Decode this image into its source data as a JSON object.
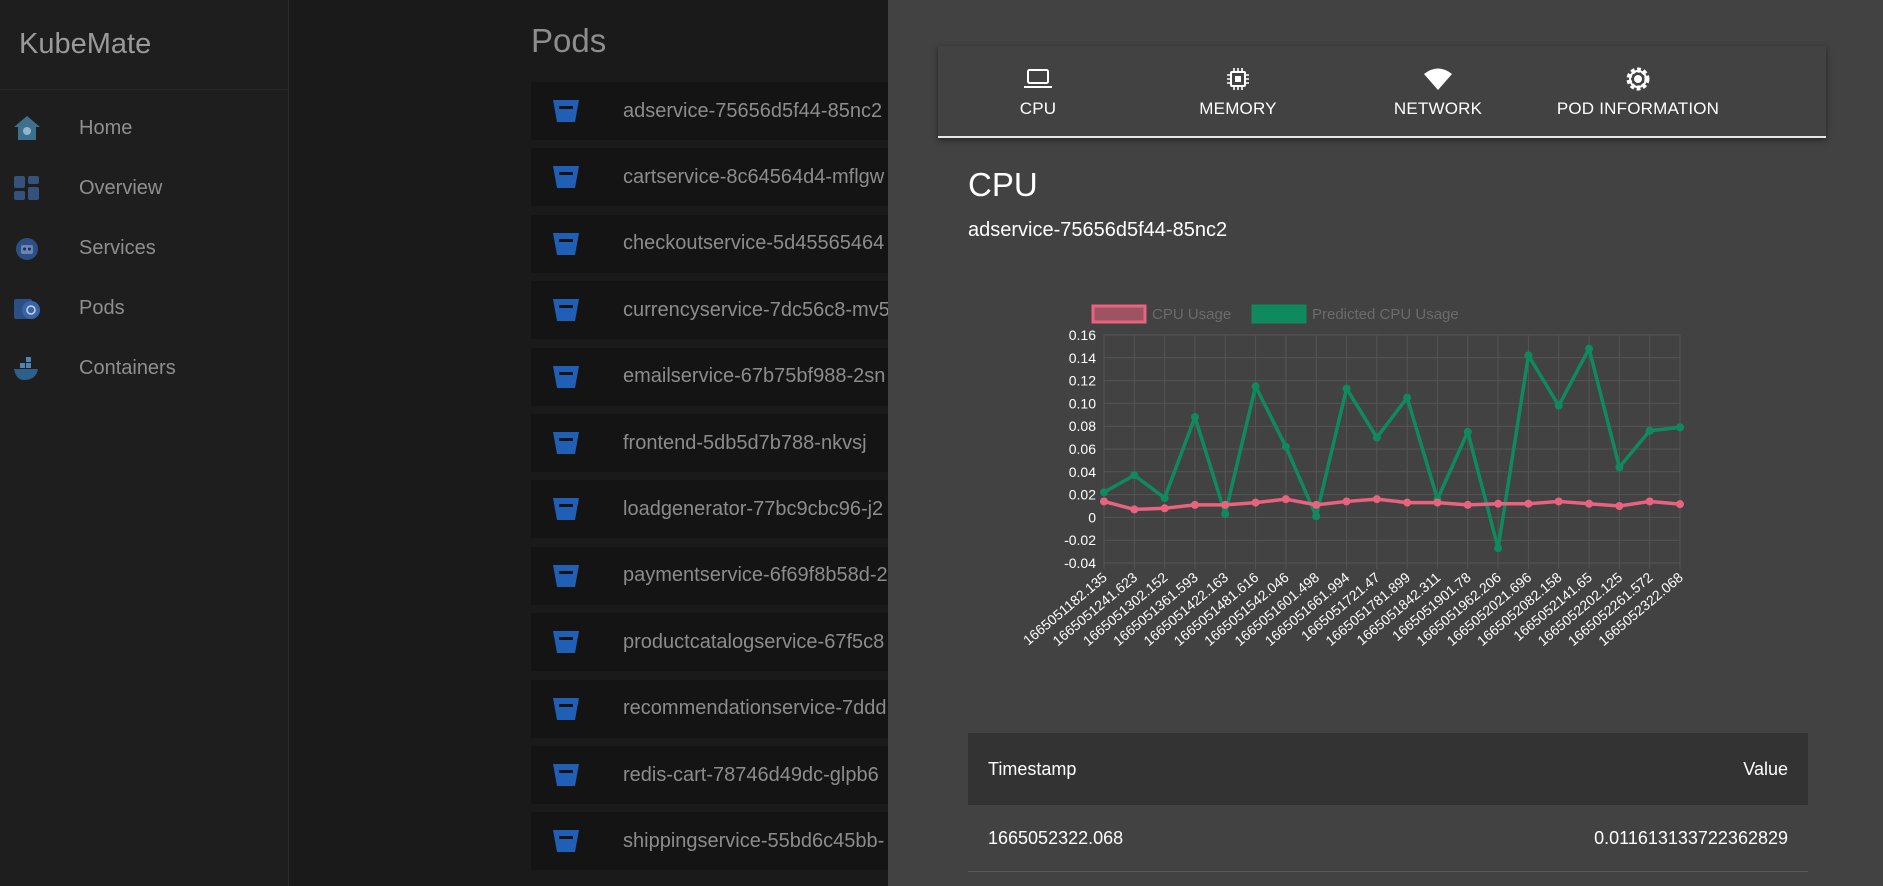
{
  "app": {
    "brand": "KubeMate"
  },
  "sidebar": {
    "items": [
      {
        "label": "Home",
        "icon": "home-icon"
      },
      {
        "label": "Overview",
        "icon": "dashboard-icon"
      },
      {
        "label": "Services",
        "icon": "robot-icon"
      },
      {
        "label": "Pods",
        "icon": "kubernetes-pod-icon"
      },
      {
        "label": "Containers",
        "icon": "docker-icon"
      }
    ]
  },
  "pods": {
    "title": "Pods",
    "items": [
      "adservice-75656d5f44-85nc2",
      "cartservice-8c64564d4-mflgw",
      "checkoutservice-5d45565464",
      "currencyservice-7dc56c8-mv5",
      "emailservice-67b75bf988-2sn",
      "frontend-5db5d7b788-nkvsj",
      "loadgenerator-77bc9cbc96-j2",
      "paymentservice-6f69f8b58d-2",
      "productcatalogservice-67f5c8",
      "recommendationservice-7ddd",
      "redis-cart-78746d49dc-glpb6",
      "shippingservice-55bd6c45bb-"
    ]
  },
  "drawer": {
    "tabs": [
      {
        "label": "CPU",
        "icon": "laptop-icon"
      },
      {
        "label": "MEMORY",
        "icon": "chip-icon"
      },
      {
        "label": "NETWORK",
        "icon": "wifi-icon"
      },
      {
        "label": "POD INFORMATION",
        "icon": "settings-icon"
      }
    ],
    "active_tab": "CPU",
    "section_title": "CPU",
    "pod_name": "adservice-75656d5f44-85nc2",
    "table": {
      "headers": [
        "Timestamp",
        "Value"
      ],
      "rows": [
        {
          "timestamp": "1665052322.068",
          "value": "0.011613133722362829"
        }
      ]
    }
  },
  "colors": {
    "cpu_usage": "#e9637f",
    "predicted": "#0f8a5f",
    "pod_icon": "#1f5fb5"
  },
  "chart_data": {
    "type": "line",
    "legend_position": "top",
    "grid": true,
    "ylim": [
      -0.04,
      0.16
    ],
    "y_ticks": [
      "0.16",
      "0.14",
      "0.12",
      "0.10",
      "0.08",
      "0.06",
      "0.04",
      "0.02",
      "0",
      "-0.02",
      "-0.04"
    ],
    "x": [
      "1665051182.135",
      "1665051241.623",
      "1665051302.152",
      "1665051361.593",
      "1665051422.163",
      "1665051481.616",
      "1665051542.046",
      "1665051601.498",
      "1665051661.994",
      "1665051721.47",
      "1665051781.899",
      "1665051842.311",
      "1665051901.78",
      "1665051962.206",
      "1665052021.696",
      "1665052082.158",
      "1665052141.65",
      "1665052202.125",
      "1665052261.572",
      "1665052322.068"
    ],
    "series": [
      {
        "name": "CPU Usage",
        "color": "#e9637f",
        "values": [
          0.014,
          0.007,
          0.008,
          0.011,
          0.011,
          0.013,
          0.016,
          0.011,
          0.014,
          0.016,
          0.013,
          0.013,
          0.011,
          0.012,
          0.012,
          0.014,
          0.012,
          0.01,
          0.014,
          0.0116
        ]
      },
      {
        "name": "Predicted CPU Usage",
        "color": "#0f8a5f",
        "values": [
          0.022,
          0.037,
          0.017,
          0.088,
          0.003,
          0.115,
          0.062,
          0.001,
          0.113,
          0.07,
          0.105,
          0.016,
          0.075,
          -0.027,
          0.142,
          0.098,
          0.148,
          0.044,
          0.076,
          0.079
        ]
      }
    ]
  }
}
